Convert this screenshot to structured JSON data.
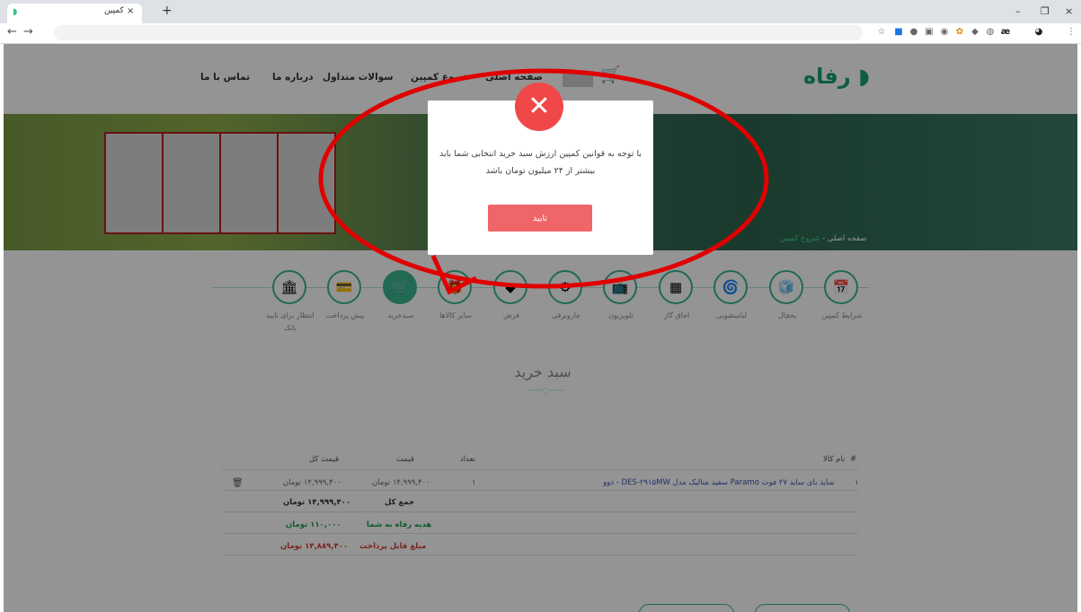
{
  "browser": {
    "tab_title": "کمپین",
    "tab_close": "×",
    "new_tab": "+",
    "window_controls": [
      "–",
      "❐",
      "×"
    ],
    "nav_back": "←",
    "nav_forward": "→"
  },
  "site": {
    "logo": "رفاه",
    "nav": [
      "صفحه اصلی",
      "شروع کمپین",
      "سوالات متداول",
      "درباره ما",
      "تماس با ما"
    ],
    "breadcrumb": {
      "home": "صفحه اصلی",
      "sep": " - ",
      "current": "شروع کمپین"
    }
  },
  "steps": [
    {
      "label": "شرایط کمپین",
      "icon": "calendar-icon"
    },
    {
      "label": "یخچال",
      "icon": "fridge-icon"
    },
    {
      "label": "لباسشویی",
      "icon": "washer-icon"
    },
    {
      "label": "اجاق گاز",
      "icon": "stove-icon"
    },
    {
      "label": "تلویزیون",
      "icon": "tv-icon"
    },
    {
      "label": "جاروبرقی",
      "icon": "vacuum-icon"
    },
    {
      "label": "فرش",
      "icon": "carpet-icon"
    },
    {
      "label": "سایر کالاها",
      "icon": "other-icon"
    },
    {
      "label": "سبدخرید",
      "icon": "cart-icon",
      "active": true
    },
    {
      "label": "پیش پرداخت",
      "icon": "payment-icon"
    },
    {
      "label": "انتظار برای تایید بانک",
      "icon": "bank-icon"
    }
  ],
  "cart": {
    "title": "سبد خرید",
    "headers": {
      "index": "#",
      "product": "نام کالا",
      "qty": "تعداد",
      "price": "قیمت",
      "total": "قیمت کل"
    },
    "rows": [
      {
        "index": "۱",
        "product": "ساید بای ساید ۲۷ فوت Paramo سفید متالیک مدل DES-۲۹۱۵MW - دوو",
        "qty": "۱",
        "price": "۱۴,۹۹۹,۴۰۰ تومان",
        "total": "۱۴,۹۹۹,۴۰۰ تومان"
      }
    ],
    "summary": [
      {
        "label": "جمع کل",
        "value": "۱۴,۹۹۹,۴۰۰ تومان"
      },
      {
        "label": "هدیه رفاه به شما",
        "value": "۱۱۰,۰۰۰ تومان"
      },
      {
        "label": "مبلغ قابل پرداخت",
        "value": "۱۴,۸۸۹,۴۰۰ تومان"
      }
    ]
  },
  "modal": {
    "message": "با توجه به قوانین کمپین ارزش سبد خرید انتخابی شما باید بیشتر از ۲۴ میلیون تومان باشد",
    "confirm": "تایید",
    "close_glyph": "✕"
  },
  "colors": {
    "accent": "#3cb58f",
    "danger": "#f04848",
    "annotation": "#e00000"
  }
}
